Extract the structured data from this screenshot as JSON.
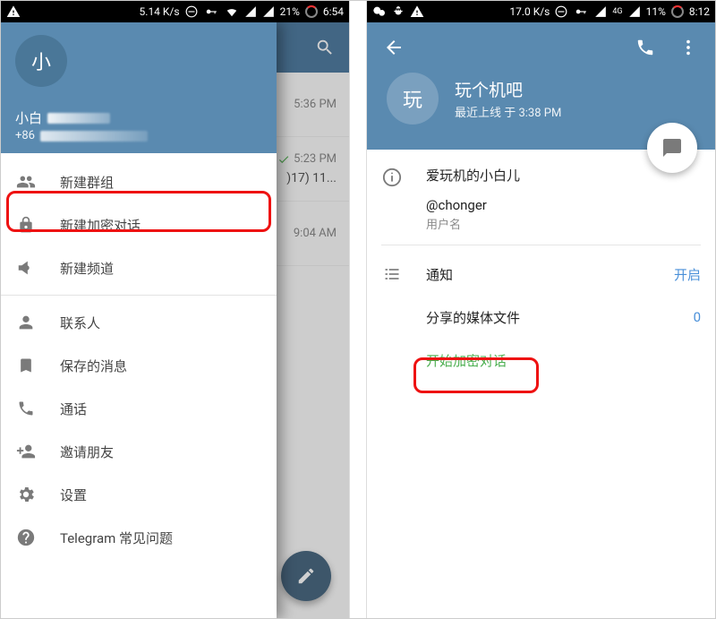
{
  "left": {
    "statusbar": {
      "speed": "5.14 K/s",
      "battery": "21%",
      "time": "6:54"
    },
    "chatlist": {
      "rows": [
        {
          "time": "5:36 PM",
          "sub": ""
        },
        {
          "time": "5:23 PM",
          "sub": ")17) 11..."
        },
        {
          "time": "9:04 AM",
          "sub": ""
        }
      ]
    },
    "drawer": {
      "avatar_letter": "小",
      "name": "小白",
      "phone_prefix": "+86",
      "items": {
        "new_group": "新建群组",
        "new_secret": "新建加密对话",
        "new_channel": "新建频道",
        "contacts": "联系人",
        "saved": "保存的消息",
        "calls": "通话",
        "invite": "邀请朋友",
        "settings": "设置",
        "faq": "Telegram 常见问题"
      }
    }
  },
  "right": {
    "statusbar": {
      "speed": "17.0 K/s",
      "net": "4G",
      "battery": "11%",
      "time": "8:12"
    },
    "profile": {
      "avatar_letter": "玩",
      "name": "玩个机吧",
      "status": "最近上线 于 3:38 PM",
      "bio": "爱玩机的小白儿",
      "username": "@chonger",
      "username_label": "用户名",
      "notifications_label": "通知",
      "notifications_value": "开启",
      "shared_label": "分享的媒体文件",
      "shared_value": "0",
      "start_secret": "开始加密对话"
    }
  }
}
